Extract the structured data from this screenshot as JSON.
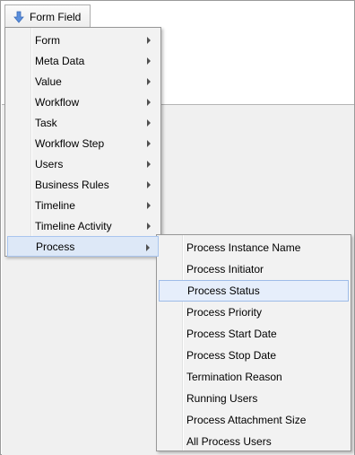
{
  "toolbar": {
    "button_label": "Form Field",
    "button_icon": "down-arrow-icon",
    "icon_color": "#4a7fd0"
  },
  "main_menu": {
    "items": [
      {
        "label": "Form"
      },
      {
        "label": "Meta Data"
      },
      {
        "label": "Value"
      },
      {
        "label": "Workflow"
      },
      {
        "label": "Task"
      },
      {
        "label": "Workflow Step"
      },
      {
        "label": "Users"
      },
      {
        "label": "Business Rules"
      },
      {
        "label": "Timeline"
      },
      {
        "label": "Timeline Activity"
      },
      {
        "label": "Process"
      }
    ],
    "active_item": "Process"
  },
  "sub_menu": {
    "items": [
      {
        "label": "Process Instance Name"
      },
      {
        "label": "Process Initiator"
      },
      {
        "label": "Process Status"
      },
      {
        "label": "Process Priority"
      },
      {
        "label": "Process Start Date"
      },
      {
        "label": "Process Stop Date"
      },
      {
        "label": "Termination Reason"
      },
      {
        "label": "Running Users"
      },
      {
        "label": "Process Attachment Size"
      },
      {
        "label": "All Process Users"
      }
    ],
    "hovered_item": "Process Status"
  }
}
